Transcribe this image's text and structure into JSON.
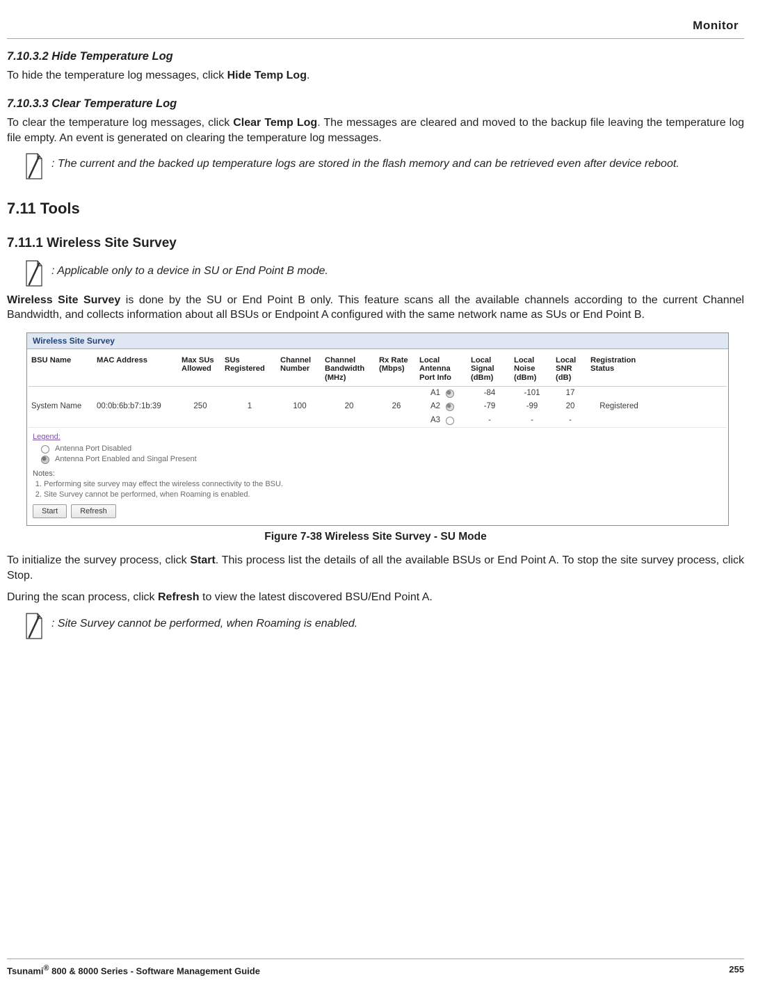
{
  "header": {
    "section": "Monitor"
  },
  "s1": {
    "num": "7.10.3.2",
    "title": "Hide Temperature Log",
    "p1a": "To hide the temperature log messages, click ",
    "p1b": "Hide Temp Log",
    "p1c": "."
  },
  "s2": {
    "num": "7.10.3.3",
    "title": "Clear Temperature Log",
    "p1a": "To clear the temperature log messages, click ",
    "p1b": "Clear Temp Log",
    "p1c": ". The messages are cleared and moved to the backup file leaving the temperature log file empty. An event is generated on clearing the temperature log messages.",
    "note": ": The current and the backed up temperature logs are stored in the flash memory and can be retrieved even after device reboot."
  },
  "h1": {
    "num": "7.11",
    "title": "Tools"
  },
  "h2": {
    "num": "7.11.1",
    "title": "Wireless Site Survey"
  },
  "note2": ": Applicable only to a device in SU or End Point B mode.",
  "p3a": "Wireless Site Survey",
  "p3b": " is done by the SU or End Point B only. This feature scans all the available channels according to the current Channel Bandwidth, and collects information about all BSUs or Endpoint A configured with the same network name as SUs or End Point B.",
  "shot": {
    "title": "Wireless Site Survey",
    "cols": {
      "c0": "BSU Name",
      "c1": "MAC Address",
      "c2": "Max SUs Allowed",
      "c3": "SUs Registered",
      "c4": "Channel Number",
      "c5": "Channel Bandwidth (MHz)",
      "c6": "Rx Rate (Mbps)",
      "c7": "Local Antenna Port Info",
      "c8": "Local Signal (dBm)",
      "c9": "Local Noise (dBm)",
      "c10": "Local SNR (dB)",
      "c11": "Registration Status"
    },
    "row": {
      "bsu": "System Name",
      "mac": "00:0b:6b:b7:1b:39",
      "max": "250",
      "sus": "1",
      "chan": "100",
      "bw": "20",
      "rx": "26",
      "ant": {
        "a1": "A1",
        "a2": "A2",
        "a3": "A3"
      },
      "sig": {
        "a1": "-84",
        "a2": "-79",
        "a3": "-"
      },
      "noise": {
        "a1": "-101",
        "a2": "-99",
        "a3": "-"
      },
      "snr": {
        "a1": "17",
        "a2": "20",
        "a3": "-"
      },
      "reg": "Registered"
    },
    "legend_label": "Legend:",
    "legend1": "Antenna Port Disabled",
    "legend2": "Antenna Port Enabled and Singal Present",
    "notes_label": "Notes:",
    "note1": "Performing site survey may effect the wireless connectivity to the BSU.",
    "note2": "Site Survey cannot be performed, when Roaming is enabled.",
    "btn_start": "Start",
    "btn_refresh": "Refresh"
  },
  "fig": "Figure 7-38 Wireless Site Survey - SU Mode",
  "p4a": "To initialize the survey process, click ",
  "p4b": "Start",
  "p4c": ". This process list the details of all the available BSUs or End Point A. To stop the site survey process, click Stop.",
  "p5a": "During the scan process, click ",
  "p5b": "Refresh",
  "p5c": " to view the latest discovered BSU/End Point A.",
  "note3": ": Site Survey cannot be performed, when Roaming is enabled.",
  "footer": {
    "left_a": "Tsunami",
    "left_b": "®",
    "left_c": " 800 & 8000 Series - Software Management Guide",
    "page": "255"
  },
  "chart_data": {
    "type": "table",
    "title": "Wireless Site Survey",
    "columns": [
      "BSU Name",
      "MAC Address",
      "Max SUs Allowed",
      "SUs Registered",
      "Channel Number",
      "Channel Bandwidth (MHz)",
      "Rx Rate (Mbps)",
      "Local Antenna Port Info",
      "Local Signal (dBm)",
      "Local Noise (dBm)",
      "Local SNR (dB)",
      "Registration Status"
    ],
    "rows": [
      {
        "BSU Name": "System Name",
        "MAC Address": "00:0b:6b:b7:1b:39",
        "Max SUs Allowed": 250,
        "SUs Registered": 1,
        "Channel Number": 100,
        "Channel Bandwidth (MHz)": 20,
        "Rx Rate (Mbps)": 26,
        "Antenna": "A1",
        "Port Enabled": true,
        "Local Signal (dBm)": -84,
        "Local Noise (dBm)": -101,
        "Local SNR (dB)": 17,
        "Registration Status": "Registered"
      },
      {
        "BSU Name": "System Name",
        "MAC Address": "00:0b:6b:b7:1b:39",
        "Max SUs Allowed": 250,
        "SUs Registered": 1,
        "Channel Number": 100,
        "Channel Bandwidth (MHz)": 20,
        "Rx Rate (Mbps)": 26,
        "Antenna": "A2",
        "Port Enabled": true,
        "Local Signal (dBm)": -79,
        "Local Noise (dBm)": -99,
        "Local SNR (dB)": 20,
        "Registration Status": "Registered"
      },
      {
        "BSU Name": "System Name",
        "MAC Address": "00:0b:6b:b7:1b:39",
        "Max SUs Allowed": 250,
        "SUs Registered": 1,
        "Channel Number": 100,
        "Channel Bandwidth (MHz)": 20,
        "Rx Rate (Mbps)": 26,
        "Antenna": "A3",
        "Port Enabled": false,
        "Local Signal (dBm)": null,
        "Local Noise (dBm)": null,
        "Local SNR (dB)": null,
        "Registration Status": "Registered"
      }
    ]
  }
}
